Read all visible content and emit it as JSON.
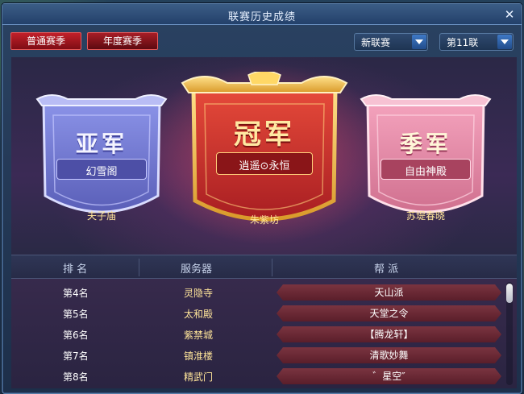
{
  "window": {
    "title": "联赛历史成绩",
    "close_label": "✕"
  },
  "season_tabs": [
    {
      "label": "普通赛季",
      "active": true
    },
    {
      "label": "年度赛季",
      "active": false
    }
  ],
  "filters": {
    "league_type": "新联赛",
    "league_number": "第11联"
  },
  "podium": {
    "runner_up": {
      "title": "亚军",
      "team": "幻雪阁",
      "server": "夫子庙",
      "color": "#7a7ed8"
    },
    "champion": {
      "title": "冠军",
      "team": "逍遥⊙永恒",
      "server": "朱紫坊",
      "color": "#d8362e"
    },
    "third": {
      "title": "季军",
      "team": "自由神殿",
      "server": "苏堤春晓",
      "color": "#e584a5"
    }
  },
  "table": {
    "columns": [
      "排 名",
      "服务器",
      "帮 派"
    ],
    "rows": [
      {
        "rank": "第4名",
        "server": "灵隐寺",
        "guild": "天山派"
      },
      {
        "rank": "第5名",
        "server": "太和殿",
        "guild": "天堂之令"
      },
      {
        "rank": "第6名",
        "server": "紫禁城",
        "guild": "【腾龙轩】"
      },
      {
        "rank": "第7名",
        "server": "镇淮楼",
        "guild": "清歌妙舞"
      },
      {
        "rank": "第8名",
        "server": "精武门",
        "guild": "゛星空″"
      }
    ]
  }
}
